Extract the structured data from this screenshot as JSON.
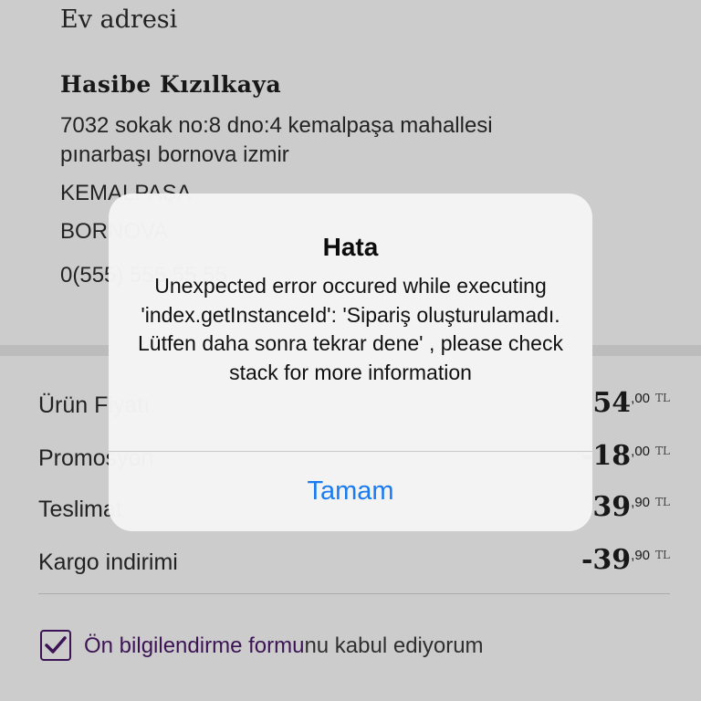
{
  "address": {
    "heading": "Ev adresi",
    "name": "Hasibe Kızılkaya",
    "lines": [
      "7032 sokak no:8 dno:4 kemalpaşa mahallesi",
      "pınarbaşı bornova izmir",
      "KEMALPAŞA",
      "BORNOVA",
      "0(555) 555 55 55"
    ]
  },
  "summary": {
    "rows": [
      {
        "label": "Ürün Fiyatı",
        "int": "54",
        "dec": ",00",
        "cur": "TL"
      },
      {
        "label": "Promosyon",
        "int": "-18",
        "dec": ",00",
        "cur": "TL"
      },
      {
        "label": "Teslimat",
        "int": "39",
        "dec": ",90",
        "cur": "TL"
      },
      {
        "label": "Kargo indirimi",
        "int": "-39",
        "dec": ",90",
        "cur": "TL"
      }
    ],
    "agreement": {
      "checked": true,
      "link_text": "Ön bilgilendirme formu",
      "rest_text": "nu kabul ediyorum"
    }
  },
  "alert": {
    "title": "Hata",
    "message": "Unexpected error occured while executing 'index.getInstanceId': 'Sipariş oluşturulamadı. Lütfen daha sonra tekrar dene' , please check stack for more information",
    "button": "Tamam"
  },
  "colors": {
    "accent": "#4b1a6b",
    "alert_button": "#1a7cf0"
  }
}
